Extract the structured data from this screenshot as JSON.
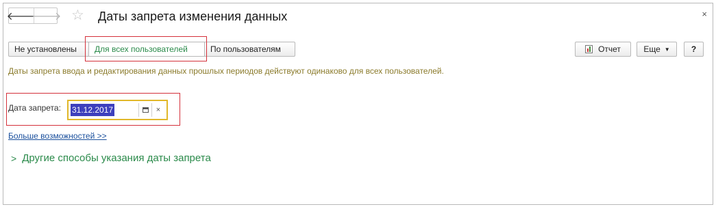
{
  "window": {
    "title": "Даты запрета изменения данных",
    "back_icon": "arrow-left-icon",
    "forward_icon": "arrow-right-icon",
    "star_icon": "star-icon",
    "close_icon": "close-icon",
    "close_glyph": "×",
    "back_glyph": "🡐",
    "forward_glyph": "🡒",
    "star_glyph": "☆"
  },
  "mode_tabs": [
    {
      "label": "Не установлены",
      "active": false
    },
    {
      "label": "Для всех пользователей",
      "active": true
    },
    {
      "label": "По пользователям",
      "active": false
    }
  ],
  "toolbar": {
    "report_label": "Отчет",
    "more_label": "Еще",
    "more_caret": "▼",
    "help_label": "?"
  },
  "hint": "Даты запрета ввода и редактирования данных прошлых периодов действуют одинаково для всех пользователей.",
  "date_field": {
    "label": "Дата запрета:",
    "value": "31.12.2017",
    "clear_glyph": "×"
  },
  "more_link": "Больше возможностей >>",
  "other_group": {
    "chevron": ">",
    "title": "Другие способы указания даты запрета"
  },
  "colors": {
    "accent_green": "#2a8a4a",
    "highlight_red": "#d4303a",
    "focus_yellow": "#e1b82a",
    "hint_olive": "#8a7a2a",
    "link_blue": "#1a4f9c",
    "selection_blue": "#3d3fbd"
  }
}
